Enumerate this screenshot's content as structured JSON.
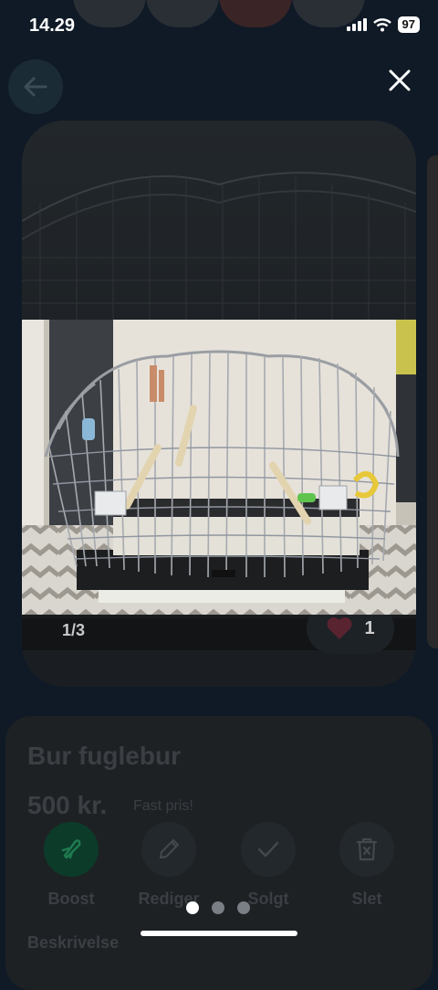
{
  "status_bar": {
    "time": "14.29",
    "battery": "97"
  },
  "listing": {
    "title": "Bur fuglebur",
    "price": "500 kr.",
    "price_tag": "Fast pris!",
    "photo_counter": "1/3",
    "like_count": "1",
    "description_heading": "Beskrivelse"
  },
  "actions": [
    {
      "label": "Boost",
      "icon": "rocket-icon"
    },
    {
      "label": "Rediger",
      "icon": "pencil-icon"
    },
    {
      "label": "Solgt",
      "icon": "checkmark-icon"
    },
    {
      "label": "Slet",
      "icon": "trash-icon"
    }
  ],
  "viewer": {
    "page_count": 3,
    "current_page": 1
  },
  "colors": {
    "background": "#0f1a26",
    "boost": "#1f7a4f",
    "heart": "#c2384f"
  }
}
